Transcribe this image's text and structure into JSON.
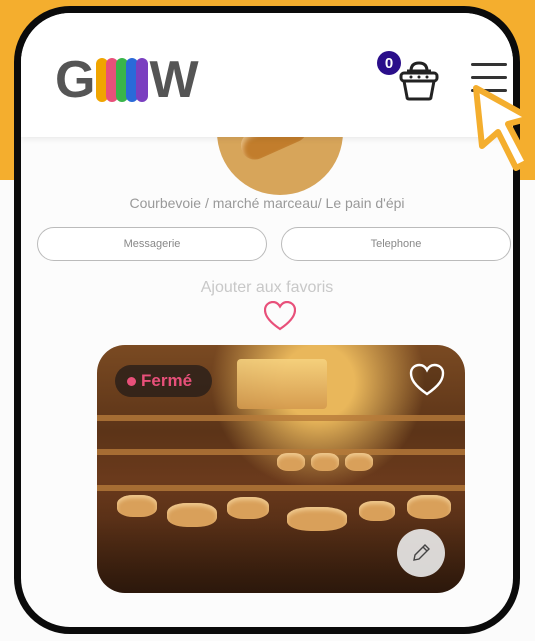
{
  "header": {
    "logo_text": "G W",
    "logo_colors": [
      "#f0a500",
      "#e8507a",
      "#39b54a",
      "#2a6ad9",
      "#7a3fc0"
    ],
    "cart_count": "0",
    "cart_icon": "basket-icon",
    "menu_icon": "hamburger-menu-icon"
  },
  "store": {
    "address": "Courbevoie / marché marceau/ Le pain d'épi",
    "buttons": {
      "messaging": "Messagerie",
      "phone": "Telephone"
    },
    "favorite_label": "Ajouter aux favoris"
  },
  "card": {
    "status": "Fermé",
    "status_color": "#e8507a"
  },
  "colors": {
    "accent_yellow": "#f4ae2e",
    "badge_blue": "#2a0e8a"
  }
}
